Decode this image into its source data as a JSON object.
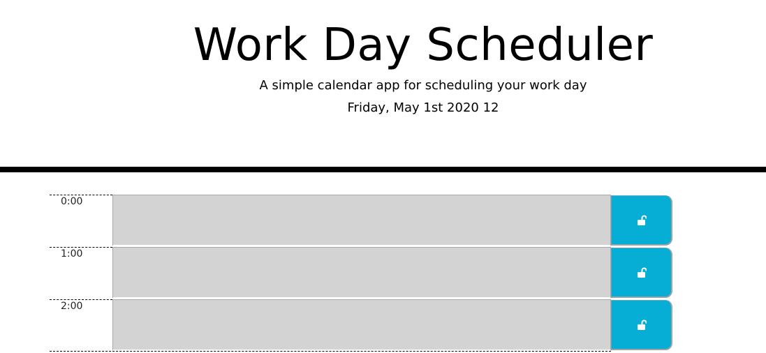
{
  "header": {
    "title": "Work Day Scheduler",
    "subtitle": "A simple calendar app for scheduling your work day",
    "current_day": "Friday, May 1st 2020 12"
  },
  "time_blocks": [
    {
      "hour": "0:00",
      "text": "",
      "state": "past",
      "save_icon": "unlock-icon"
    },
    {
      "hour": "1:00",
      "text": "",
      "state": "past",
      "save_icon": "unlock-icon"
    },
    {
      "hour": "2:00",
      "text": "",
      "state": "past",
      "save_icon": "unlock-icon"
    }
  ],
  "colors": {
    "past": "#d3d3d3",
    "save_button": "#06aed5",
    "divider": "#000000"
  }
}
